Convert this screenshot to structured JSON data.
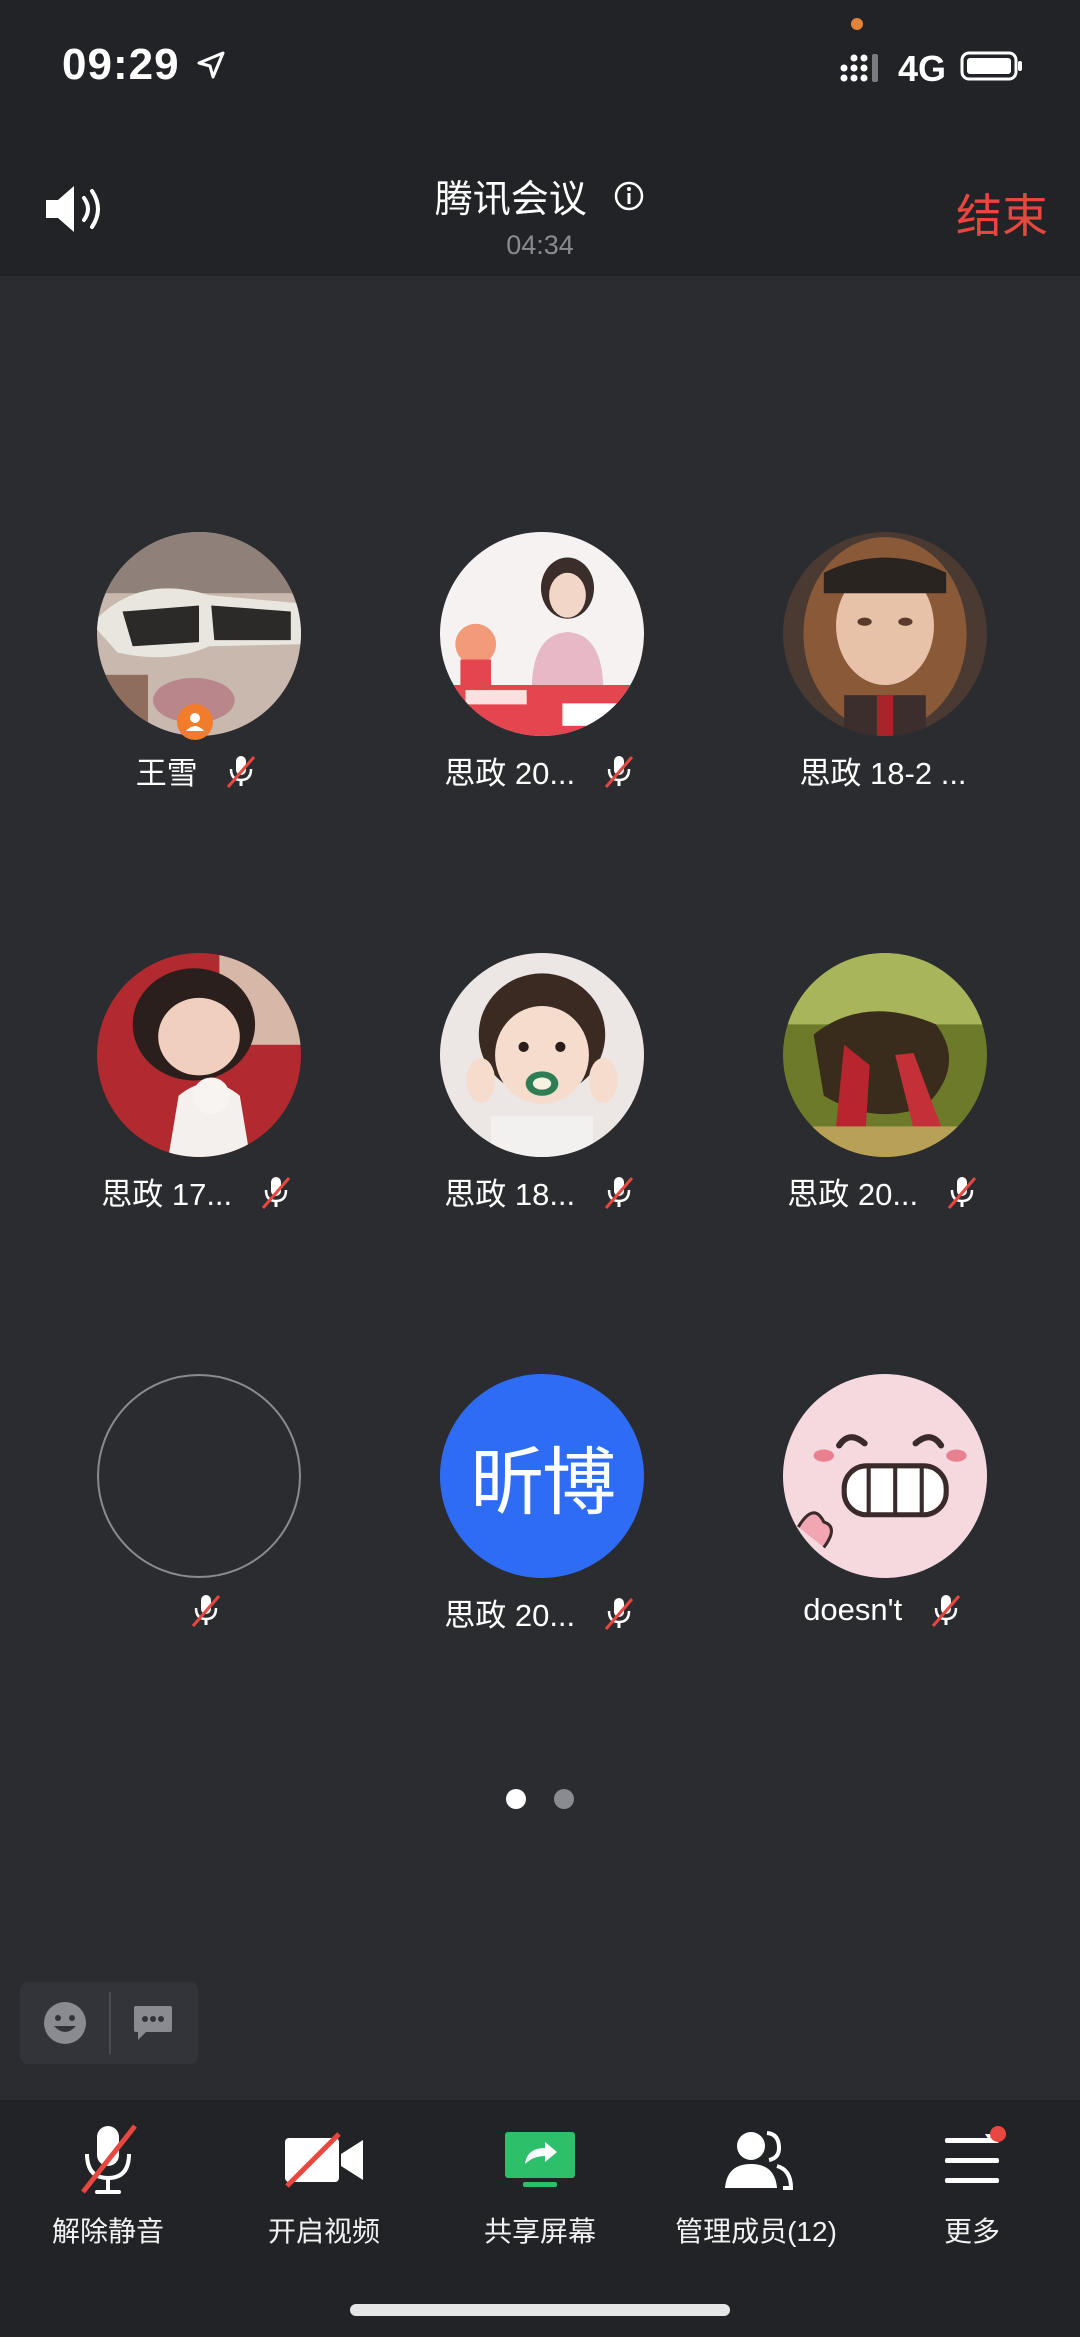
{
  "status_bar": {
    "time": "09:29",
    "network": "4G"
  },
  "header": {
    "title": "腾讯会议",
    "timer": "04:34",
    "end_label": "结束"
  },
  "participants": [
    {
      "name": "王雪",
      "avatar": "photo-sunglasses",
      "host": true,
      "muted": true
    },
    {
      "name": "思政 20...",
      "avatar": "photo-teacher-ad",
      "host": false,
      "muted": true
    },
    {
      "name": "思政 18-2 ...",
      "avatar": "photo-girl-braids",
      "host": false,
      "muted": false
    },
    {
      "name": "思政 17...",
      "avatar": "photo-woman-cat",
      "host": false,
      "muted": true
    },
    {
      "name": "思政 18...",
      "avatar": "photo-child",
      "host": false,
      "muted": true
    },
    {
      "name": "思政 20...",
      "avatar": "photo-nature",
      "host": false,
      "muted": true
    },
    {
      "name": "",
      "avatar": "none",
      "host": false,
      "muted": true
    },
    {
      "name": "思政 20...",
      "avatar": "text",
      "avatar_text": "昕博",
      "avatar_color": "#2f6cf5",
      "host": false,
      "muted": true
    },
    {
      "name": "doesn't",
      "avatar": "cartoon-pig",
      "host": false,
      "muted": true
    }
  ],
  "pager": {
    "pages": 2,
    "current": 1
  },
  "toolbar": {
    "unmute": "解除静音",
    "video": "开启视频",
    "share": "共享屏幕",
    "members": "管理成员(12)",
    "more": "更多"
  },
  "colors": {
    "accent_red": "#e8473f",
    "share_green": "#2dbf6a",
    "avatar_blue": "#2f6cf5",
    "host_orange": "#f07c2c"
  }
}
